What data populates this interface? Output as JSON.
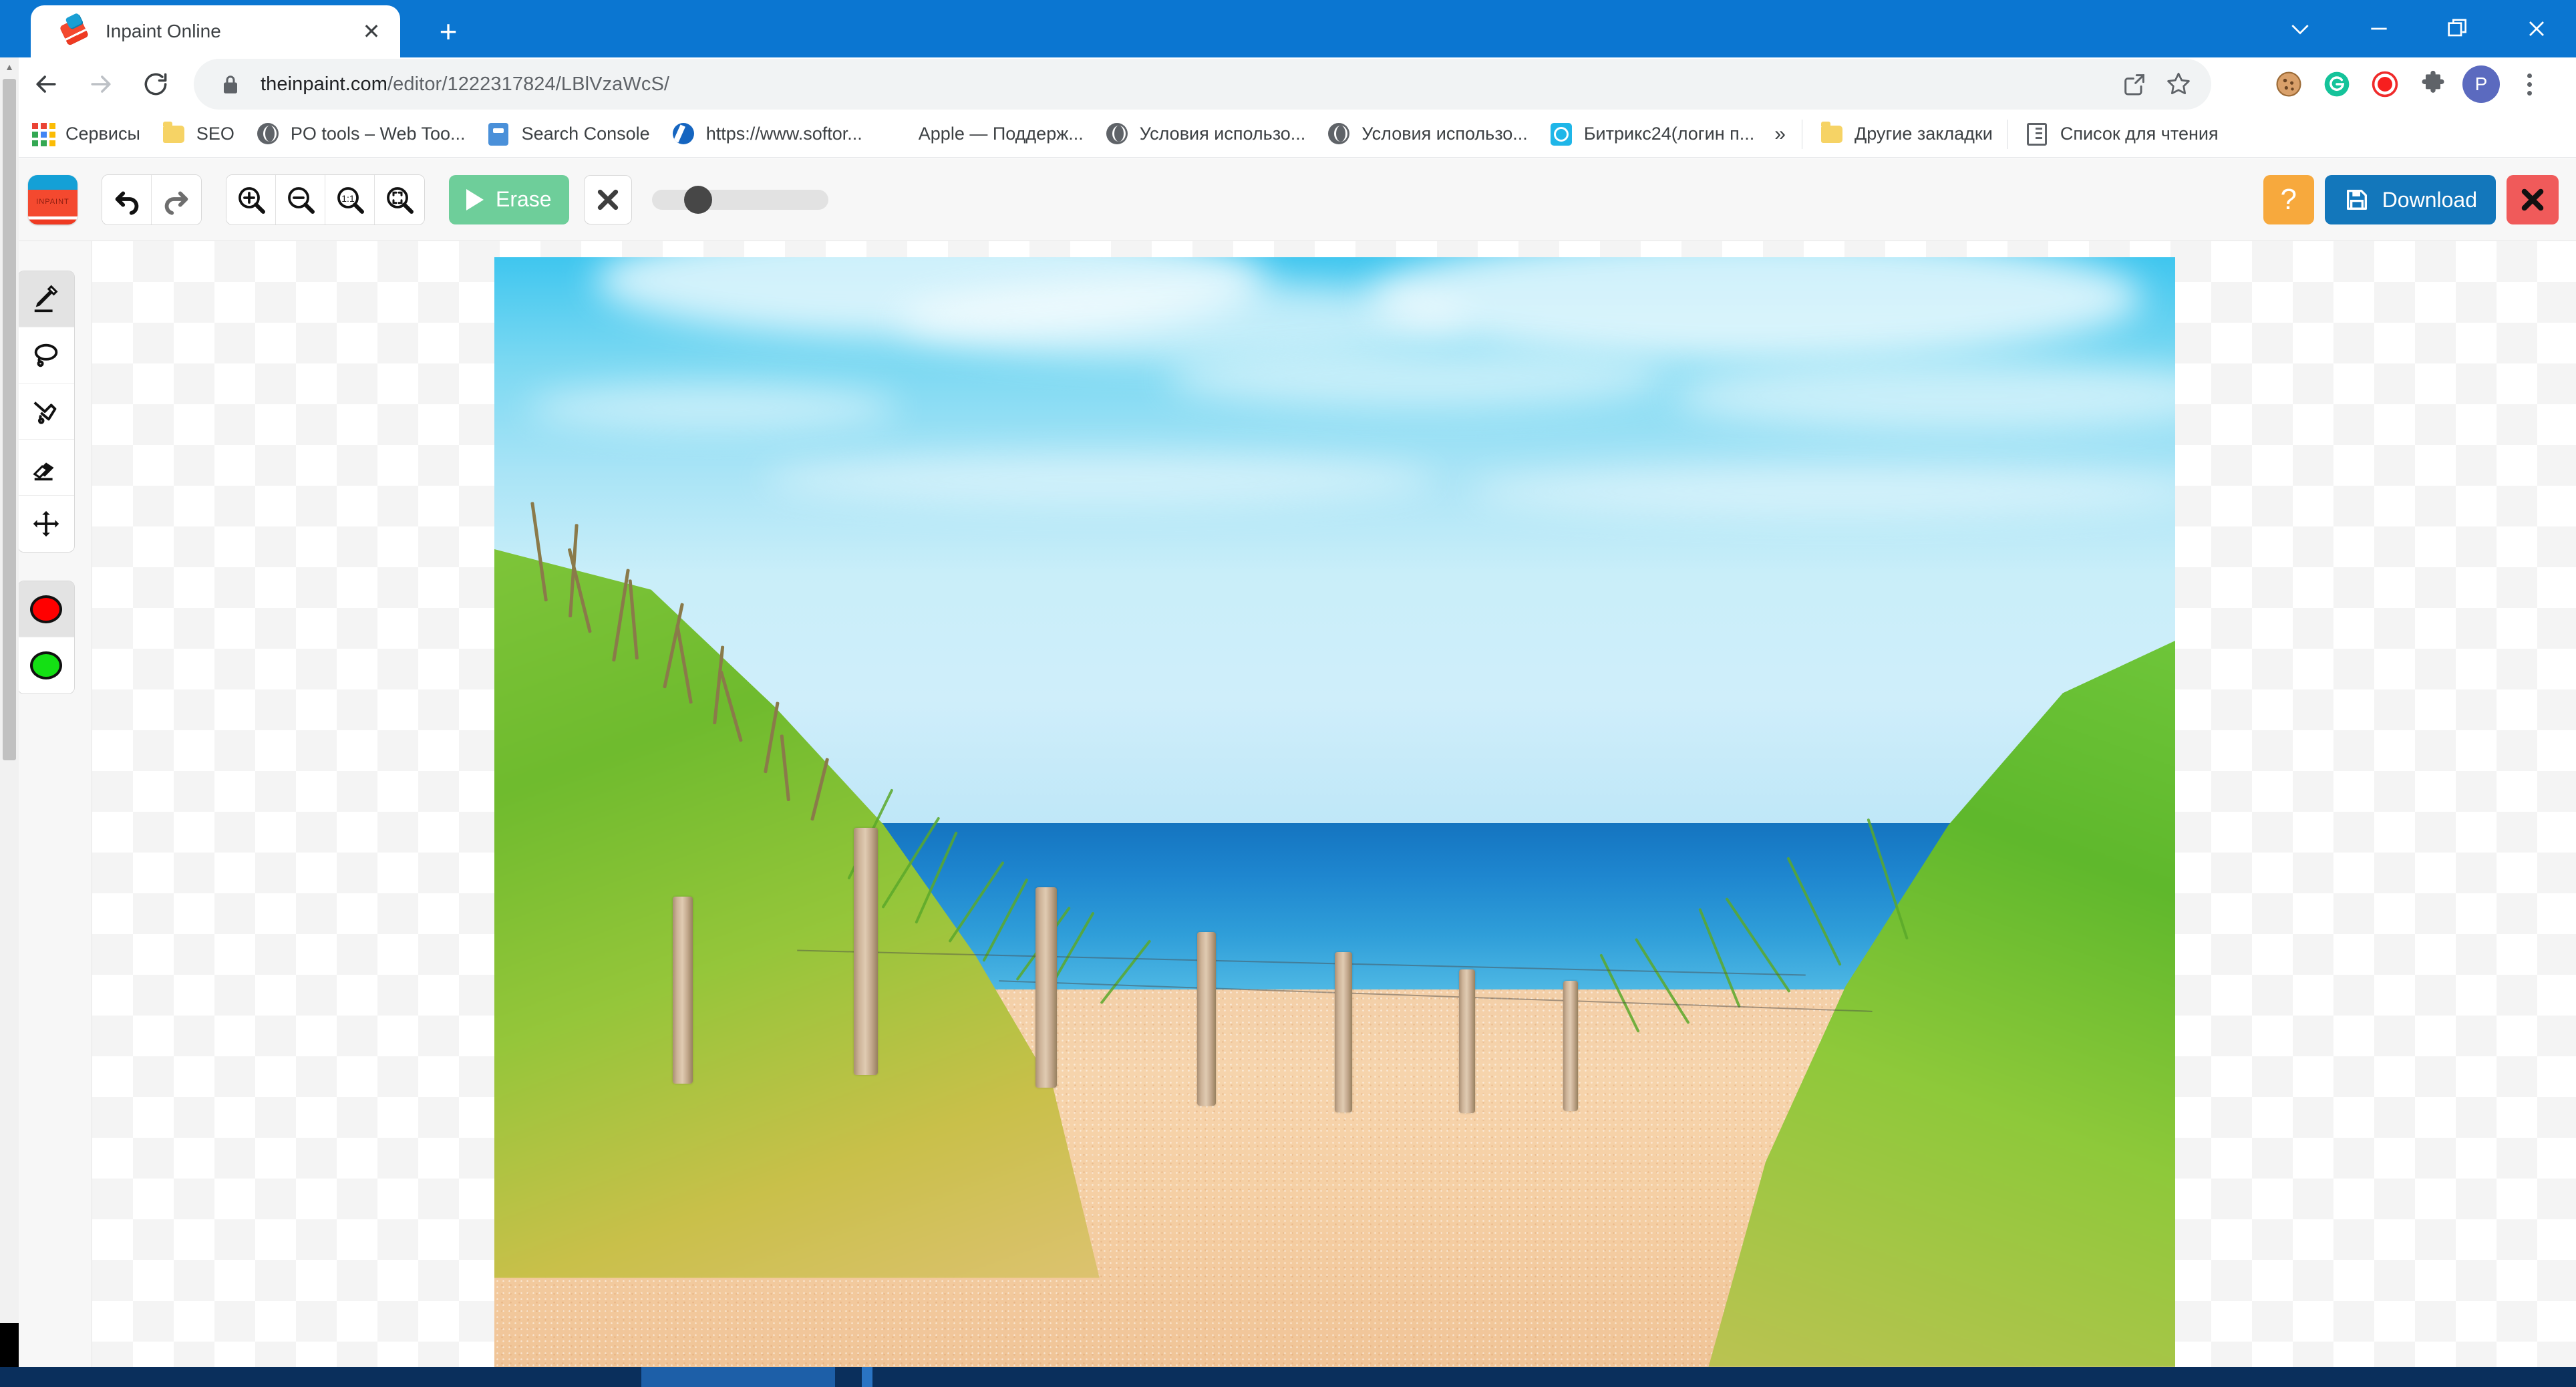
{
  "browser": {
    "tab": {
      "title": "Inpaint Online",
      "favicon": "inpaint-eraser-icon",
      "close_label": "✕"
    },
    "new_tab_label": "+",
    "window_controls": {
      "tab_search": "⌄",
      "minimize": "—",
      "restore": "❐",
      "close": "✕"
    },
    "nav": {
      "back": "←",
      "forward": "→",
      "reload": "⟳"
    },
    "omnibox": {
      "lock": "lock-icon",
      "url_domain": "theinpaint.com",
      "url_path": "/editor/1222317824/LBlVzaWcS/",
      "share": "share-icon",
      "bookmark_star": "☆"
    },
    "extensions": [
      {
        "name": "cookie-extension-icon",
        "glyph": "🍪"
      },
      {
        "name": "grammarly-extension-icon",
        "glyph": "G"
      },
      {
        "name": "screen-recorder-icon",
        "glyph": "●"
      },
      {
        "name": "extensions-puzzle-icon",
        "glyph": "🧩"
      }
    ],
    "profile_initial": "P",
    "menu": "kebab-menu-icon",
    "bookmarks": [
      {
        "label": "Сервисы",
        "icon": "apps-grid-icon"
      },
      {
        "label": "SEO",
        "icon": "folder-icon"
      },
      {
        "label": "PO tools – Web Too...",
        "icon": "globe-icon"
      },
      {
        "label": "Search Console",
        "icon": "search-console-icon"
      },
      {
        "label": "https://www.softor...",
        "icon": "softonic-icon"
      },
      {
        "label": "Apple — Поддерж...",
        "icon": "apple-icon"
      },
      {
        "label": "Условия использо...",
        "icon": "globe-icon"
      },
      {
        "label": "Условия использо...",
        "icon": "globe-icon"
      },
      {
        "label": "Битрикс24(логин п...",
        "icon": "bitrix24-icon"
      }
    ],
    "bookmarks_overflow": "»",
    "other_bookmarks": {
      "label": "Другие закладки",
      "icon": "folder-icon"
    },
    "reading_list": {
      "label": "Список для чтения",
      "icon": "reading-list-icon"
    }
  },
  "app": {
    "logo_text": "INPAINT",
    "history": [
      {
        "name": "undo-button",
        "glyph": "↶",
        "enabled": true
      },
      {
        "name": "redo-button",
        "glyph": "↷",
        "enabled": false
      }
    ],
    "zoom_buttons": [
      {
        "name": "zoom-in-button",
        "glyph": "+"
      },
      {
        "name": "zoom-out-button",
        "glyph": "−"
      },
      {
        "name": "zoom-actual-size-button",
        "glyph": "1:1"
      },
      {
        "name": "zoom-fit-button",
        "glyph": "⛶"
      }
    ],
    "erase_label": "Erase",
    "clear_label": "✕",
    "brush_slider": {
      "value_percent": 28,
      "min": 0,
      "max": 100
    },
    "help_label": "?",
    "download_label": "Download",
    "close_label": "✕",
    "tools": [
      {
        "name": "marker-tool",
        "label": "Marker",
        "selected": true
      },
      {
        "name": "lasso-tool",
        "label": "Lasso",
        "selected": false
      },
      {
        "name": "polygon-lasso-tool",
        "label": "Polygonal lasso",
        "selected": false
      },
      {
        "name": "eraser-tool",
        "label": "Eraser",
        "selected": false
      },
      {
        "name": "move-tool",
        "label": "Move",
        "selected": false
      }
    ],
    "colors": [
      {
        "name": "red-mask-color",
        "hex": "#ff0000",
        "selected": true
      },
      {
        "name": "green-donor-color",
        "hex": "#14e014",
        "selected": false
      }
    ]
  },
  "theme": {
    "chrome_blue": "#0b76d1",
    "erase_green": "#6ece9a",
    "download_blue": "#1377bb",
    "help_orange": "#f7a93d",
    "close_red": "#f05a5a",
    "toolbar_bg": "#f7f7f7",
    "taskbar_navy": "#0a2f5c"
  },
  "canvas": {
    "image_alt": "Sandy path through dune grass with wooden fence posts leading to the blue sea",
    "transparency_checker": true
  }
}
